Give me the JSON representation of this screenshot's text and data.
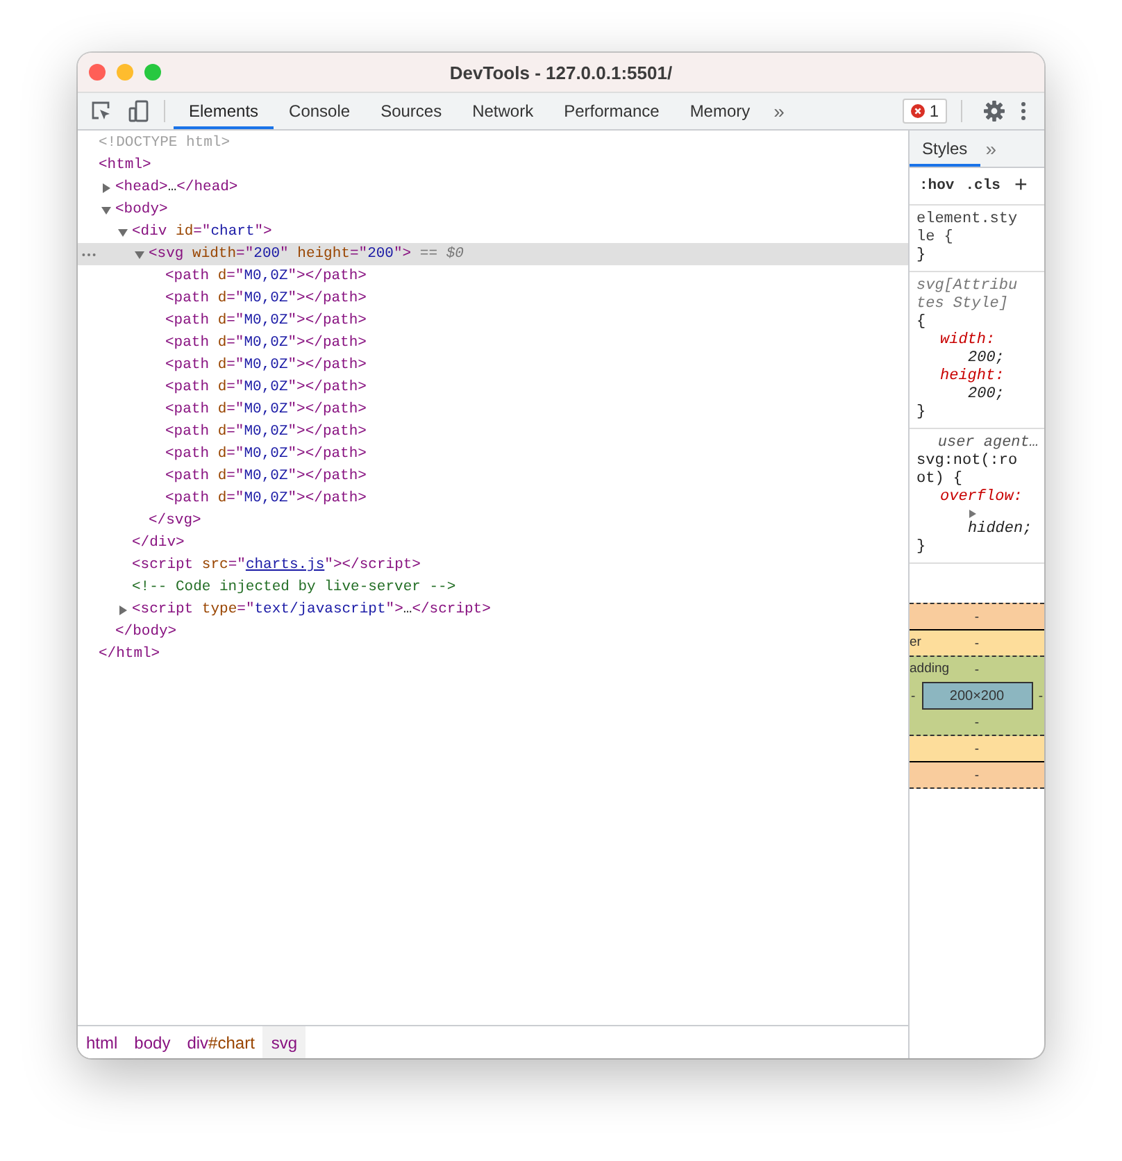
{
  "window": {
    "title": "DevTools - 127.0.0.1:5501/"
  },
  "tabs": [
    {
      "label": "Elements",
      "selected": true
    },
    {
      "label": "Console",
      "selected": false
    },
    {
      "label": "Sources",
      "selected": false
    },
    {
      "label": "Network",
      "selected": false
    },
    {
      "label": "Performance",
      "selected": false
    },
    {
      "label": "Memory",
      "selected": false
    }
  ],
  "more_tabs": "»",
  "error_count": "1",
  "dom_tree": [
    {
      "tokens": [
        {
          "kind": "doctype",
          "text": "<!DOCTYPE html>"
        }
      ],
      "selected": false
    },
    {
      "tokens": [
        {
          "kind": "tag",
          "text": "<html>"
        }
      ],
      "selected": false,
      "close": [
        {
          "kind": "tag",
          "text": "</html>"
        }
      ],
      "children": [
        {
          "tokens": [
            {
              "kind": "tag",
              "text": "<head>"
            },
            {
              "kind": "text",
              "text": "…"
            },
            {
              "kind": "tag",
              "text": "</head>"
            }
          ],
          "expanded": false,
          "selected": false
        },
        {
          "tokens": [
            {
              "kind": "tag",
              "text": "<body>"
            }
          ],
          "expanded": true,
          "selected": false,
          "close": [
            {
              "kind": "tag",
              "text": "</body>"
            }
          ],
          "children": [
            {
              "tokens": [
                {
                  "kind": "tag",
                  "text": "<div "
                },
                {
                  "kind": "attr",
                  "text": "id"
                },
                {
                  "kind": "tag",
                  "text": "=\""
                },
                {
                  "kind": "value",
                  "text": "chart"
                },
                {
                  "kind": "tag",
                  "text": "\">"
                }
              ],
              "expanded": true,
              "selected": false,
              "close": [
                {
                  "kind": "tag",
                  "text": "</div>"
                }
              ],
              "children": [
                {
                  "tokens": [
                    {
                      "kind": "tag",
                      "text": "<svg "
                    },
                    {
                      "kind": "attr",
                      "text": "width"
                    },
                    {
                      "kind": "tag",
                      "text": "=\""
                    },
                    {
                      "kind": "value",
                      "text": "200"
                    },
                    {
                      "kind": "tag",
                      "text": "\" "
                    },
                    {
                      "kind": "attr",
                      "text": "height"
                    },
                    {
                      "kind": "tag",
                      "text": "=\""
                    },
                    {
                      "kind": "value",
                      "text": "200"
                    },
                    {
                      "kind": "tag",
                      "text": "\">"
                    },
                    {
                      "kind": "hint",
                      "text": " == *$0*"
                    }
                  ],
                  "expanded": true,
                  "selected": true,
                  "close": [
                    {
                      "kind": "tag",
                      "text": "</svg>"
                    }
                  ],
                  "children": [
                    {
                      "tokens": [
                        {
                          "kind": "tag",
                          "text": "<path "
                        },
                        {
                          "kind": "attr",
                          "text": "d"
                        },
                        {
                          "kind": "tag",
                          "text": "=\""
                        },
                        {
                          "kind": "value",
                          "text": "M0,0Z"
                        },
                        {
                          "kind": "tag",
                          "text": "\"></path>"
                        }
                      ],
                      "selected": false
                    },
                    {
                      "tokens": [
                        {
                          "kind": "tag",
                          "text": "<path "
                        },
                        {
                          "kind": "attr",
                          "text": "d"
                        },
                        {
                          "kind": "tag",
                          "text": "=\""
                        },
                        {
                          "kind": "value",
                          "text": "M0,0Z"
                        },
                        {
                          "kind": "tag",
                          "text": "\"></path>"
                        }
                      ],
                      "selected": false
                    },
                    {
                      "tokens": [
                        {
                          "kind": "tag",
                          "text": "<path "
                        },
                        {
                          "kind": "attr",
                          "text": "d"
                        },
                        {
                          "kind": "tag",
                          "text": "=\""
                        },
                        {
                          "kind": "value",
                          "text": "M0,0Z"
                        },
                        {
                          "kind": "tag",
                          "text": "\"></path>"
                        }
                      ],
                      "selected": false
                    },
                    {
                      "tokens": [
                        {
                          "kind": "tag",
                          "text": "<path "
                        },
                        {
                          "kind": "attr",
                          "text": "d"
                        },
                        {
                          "kind": "tag",
                          "text": "=\""
                        },
                        {
                          "kind": "value",
                          "text": "M0,0Z"
                        },
                        {
                          "kind": "tag",
                          "text": "\"></path>"
                        }
                      ],
                      "selected": false
                    },
                    {
                      "tokens": [
                        {
                          "kind": "tag",
                          "text": "<path "
                        },
                        {
                          "kind": "attr",
                          "text": "d"
                        },
                        {
                          "kind": "tag",
                          "text": "=\""
                        },
                        {
                          "kind": "value",
                          "text": "M0,0Z"
                        },
                        {
                          "kind": "tag",
                          "text": "\"></path>"
                        }
                      ],
                      "selected": false
                    },
                    {
                      "tokens": [
                        {
                          "kind": "tag",
                          "text": "<path "
                        },
                        {
                          "kind": "attr",
                          "text": "d"
                        },
                        {
                          "kind": "tag",
                          "text": "=\""
                        },
                        {
                          "kind": "value",
                          "text": "M0,0Z"
                        },
                        {
                          "kind": "tag",
                          "text": "\"></path>"
                        }
                      ],
                      "selected": false
                    },
                    {
                      "tokens": [
                        {
                          "kind": "tag",
                          "text": "<path "
                        },
                        {
                          "kind": "attr",
                          "text": "d"
                        },
                        {
                          "kind": "tag",
                          "text": "=\""
                        },
                        {
                          "kind": "value",
                          "text": "M0,0Z"
                        },
                        {
                          "kind": "tag",
                          "text": "\"></path>"
                        }
                      ],
                      "selected": false
                    },
                    {
                      "tokens": [
                        {
                          "kind": "tag",
                          "text": "<path "
                        },
                        {
                          "kind": "attr",
                          "text": "d"
                        },
                        {
                          "kind": "tag",
                          "text": "=\""
                        },
                        {
                          "kind": "value",
                          "text": "M0,0Z"
                        },
                        {
                          "kind": "tag",
                          "text": "\"></path>"
                        }
                      ],
                      "selected": false
                    },
                    {
                      "tokens": [
                        {
                          "kind": "tag",
                          "text": "<path "
                        },
                        {
                          "kind": "attr",
                          "text": "d"
                        },
                        {
                          "kind": "tag",
                          "text": "=\""
                        },
                        {
                          "kind": "value",
                          "text": "M0,0Z"
                        },
                        {
                          "kind": "tag",
                          "text": "\"></path>"
                        }
                      ],
                      "selected": false
                    },
                    {
                      "tokens": [
                        {
                          "kind": "tag",
                          "text": "<path "
                        },
                        {
                          "kind": "attr",
                          "text": "d"
                        },
                        {
                          "kind": "tag",
                          "text": "=\""
                        },
                        {
                          "kind": "value",
                          "text": "M0,0Z"
                        },
                        {
                          "kind": "tag",
                          "text": "\"></path>"
                        }
                      ],
                      "selected": false
                    },
                    {
                      "tokens": [
                        {
                          "kind": "tag",
                          "text": "<path "
                        },
                        {
                          "kind": "attr",
                          "text": "d"
                        },
                        {
                          "kind": "tag",
                          "text": "=\""
                        },
                        {
                          "kind": "value",
                          "text": "M0,0Z"
                        },
                        {
                          "kind": "tag",
                          "text": "\"></path>"
                        }
                      ],
                      "selected": false
                    }
                  ]
                }
              ]
            },
            {
              "tokens": [
                {
                  "kind": "tag",
                  "text": "<script "
                },
                {
                  "kind": "attr",
                  "text": "src"
                },
                {
                  "kind": "tag",
                  "text": "=\""
                },
                {
                  "kind": "link",
                  "text": "charts.js"
                },
                {
                  "kind": "tag",
                  "text": "\"></script>"
                }
              ],
              "selected": false
            },
            {
              "tokens": [
                {
                  "kind": "comment",
                  "text": "<!-- Code injected by live-server -->"
                }
              ],
              "selected": false
            },
            {
              "tokens": [
                {
                  "kind": "tag",
                  "text": "<script "
                },
                {
                  "kind": "attr",
                  "text": "type"
                },
                {
                  "kind": "tag",
                  "text": "=\""
                },
                {
                  "kind": "value",
                  "text": "text/javascript"
                },
                {
                  "kind": "tag",
                  "text": "\">"
                },
                {
                  "kind": "text",
                  "text": "…"
                },
                {
                  "kind": "tag",
                  "text": "</script>"
                }
              ],
              "expanded": false,
              "selected": false
            }
          ]
        }
      ]
    }
  ],
  "breadcrumbs": [
    {
      "tag": "html",
      "selected": false
    },
    {
      "tag": "body",
      "selected": false
    },
    {
      "tag": "div",
      "id": "#chart",
      "selected": false
    },
    {
      "tag": "svg",
      "selected": true
    }
  ],
  "sidebar": {
    "tabs": [
      {
        "label": "Styles",
        "selected": true
      }
    ],
    "more_tabs": "»",
    "toolbar": [
      ":hov",
      ".cls",
      "+"
    ],
    "rules": [
      {
        "kind": "inline",
        "selector": "element.style {",
        "close": "}"
      },
      {
        "kind": "attributes",
        "selector": "svg[Attributes Style]",
        "open": "{",
        "declarations": [
          {
            "name": "width:",
            "value": "200;"
          },
          {
            "name": "height:",
            "value": "200;"
          }
        ],
        "close": "}"
      },
      {
        "kind": "user-agent",
        "source": "user agent…",
        "selector": "svg:not(:root) {",
        "declarations": [
          {
            "name": "overflow:",
            "value": "hidden;",
            "expanded": false
          }
        ],
        "close": "}"
      }
    ],
    "box_model": {
      "margin": {
        "top": "-",
        "bottom": "-"
      },
      "border": {
        "label": "er",
        "top": "-",
        "bottom": "-"
      },
      "padding": {
        "label": "adding",
        "top": "-",
        "left": "-",
        "right": "-",
        "bottom": "-"
      },
      "content": "200×200"
    }
  }
}
